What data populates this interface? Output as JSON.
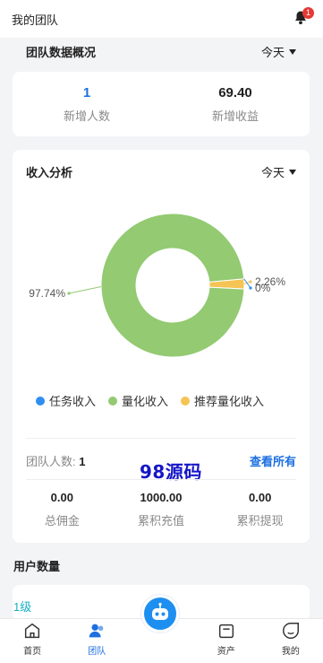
{
  "topbar": {
    "title": "我的团队",
    "badge": "1"
  },
  "overview": {
    "title": "团队数据概况",
    "period": "今天",
    "new_members_value": "1",
    "new_members_label": "新增人数",
    "new_income_value": "69.40",
    "new_income_label": "新增收益"
  },
  "analysis": {
    "title": "收入分析",
    "period": "今天",
    "legend": {
      "task": "任务收入",
      "quant": "量化收入",
      "referral": "推荐量化收入"
    },
    "team_count_label": "团队人数:",
    "team_count_value": "1",
    "view_all": "查看所有",
    "total_commission_value": "0.00",
    "total_commission_label": "总佣金",
    "total_recharge_value": "1000.00",
    "total_recharge_label": "累积充值",
    "total_withdraw_value": "0.00",
    "total_withdraw_label": "累积提现",
    "watermark": "98源码"
  },
  "chart_data": {
    "type": "pie",
    "series": [
      {
        "name": "任务收入",
        "value_label": "0%",
        "value": 0,
        "color": "#2f8ef0"
      },
      {
        "name": "量化收入",
        "value_label": "97.74%",
        "value": 97.74,
        "color": "#93ca72"
      },
      {
        "name": "推荐量化收入",
        "value_label": "2.26%",
        "value": 2.26,
        "color": "#f5c454"
      }
    ]
  },
  "users": {
    "title": "用户数量",
    "level": "1级"
  },
  "tabs": {
    "home": "首页",
    "team": "团队",
    "assets": "资产",
    "mine": "我的"
  },
  "colors": {
    "accent": "#1d6fe0",
    "quant": "#93ca72",
    "referral": "#f5c454",
    "task": "#2f8ef0"
  }
}
